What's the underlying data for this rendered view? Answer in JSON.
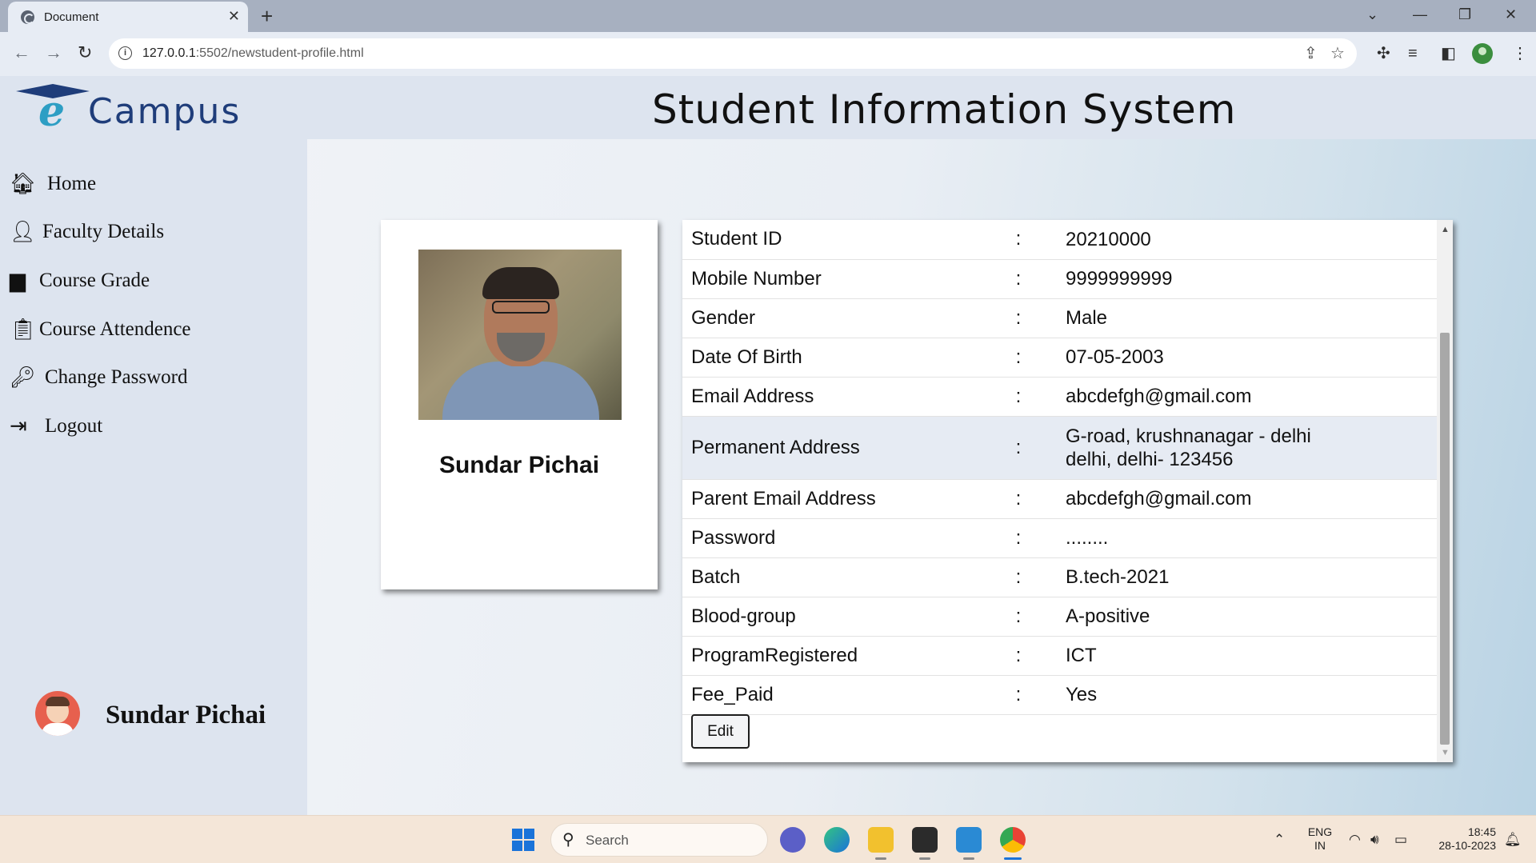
{
  "browser": {
    "tab_title": "Document",
    "tab_close": "✕",
    "new_tab": "+",
    "url_host": "127.0.0.1",
    "url_path": ":5502/newstudent-profile.html"
  },
  "header": {
    "logo_e": "e",
    "logo_text": "Campus",
    "title": "Student Information System"
  },
  "sidebar": {
    "items": [
      {
        "label": "Home",
        "icon": "home-icon"
      },
      {
        "label": "Faculty Details",
        "icon": "user-icon"
      },
      {
        "label": "Course Grade",
        "icon": "file-icon"
      },
      {
        "label": "Course Attendence",
        "icon": "clipboard-icon"
      },
      {
        "label": "Change Password",
        "icon": "key-icon"
      },
      {
        "label": "Logout",
        "icon": "sign-in-icon"
      }
    ],
    "user_name": "Sundar Pichai"
  },
  "profile": {
    "name": "Sundar Pichai"
  },
  "details": {
    "rows": [
      {
        "label": "Student ID",
        "sep": ":",
        "value": "20210000"
      },
      {
        "label": "Mobile Number",
        "sep": ":",
        "value": "9999999999"
      },
      {
        "label": "Gender",
        "sep": ":",
        "value": "Male"
      },
      {
        "label": "Date Of Birth",
        "sep": ":",
        "value": "07-05-2003"
      },
      {
        "label": "Email Address",
        "sep": ":",
        "value": "abcdefgh@gmail.com"
      },
      {
        "label": "Permanent Address",
        "sep": ":",
        "value_line1": "G-road, krushnanagar - delhi",
        "value_line2": "delhi, delhi- 123456"
      },
      {
        "label": "Parent Email Address",
        "sep": ":",
        "value": "abcdefgh@gmail.com"
      },
      {
        "label": "Password",
        "sep": ":",
        "value": "........"
      },
      {
        "label": "Batch",
        "sep": ":",
        "value": "B.tech-2021"
      },
      {
        "label": "Blood-group",
        "sep": ":",
        "value": "A-positive"
      },
      {
        "label": "ProgramRegistered",
        "sep": ":",
        "value": "ICT"
      },
      {
        "label": "Fee_Paid",
        "sep": ":",
        "value": "Yes"
      }
    ],
    "edit_label": "Edit"
  },
  "taskbar": {
    "search_placeholder": "Search",
    "lang_line1": "ENG",
    "lang_line2": "IN",
    "time": "18:45",
    "date": "28-10-2023"
  },
  "colors": {
    "brand_navy": "#1f3d7a",
    "brand_teal": "#2d9ec4",
    "sidebar_bg": "#dde4ef",
    "highlight_row": "#e6ebf3"
  }
}
